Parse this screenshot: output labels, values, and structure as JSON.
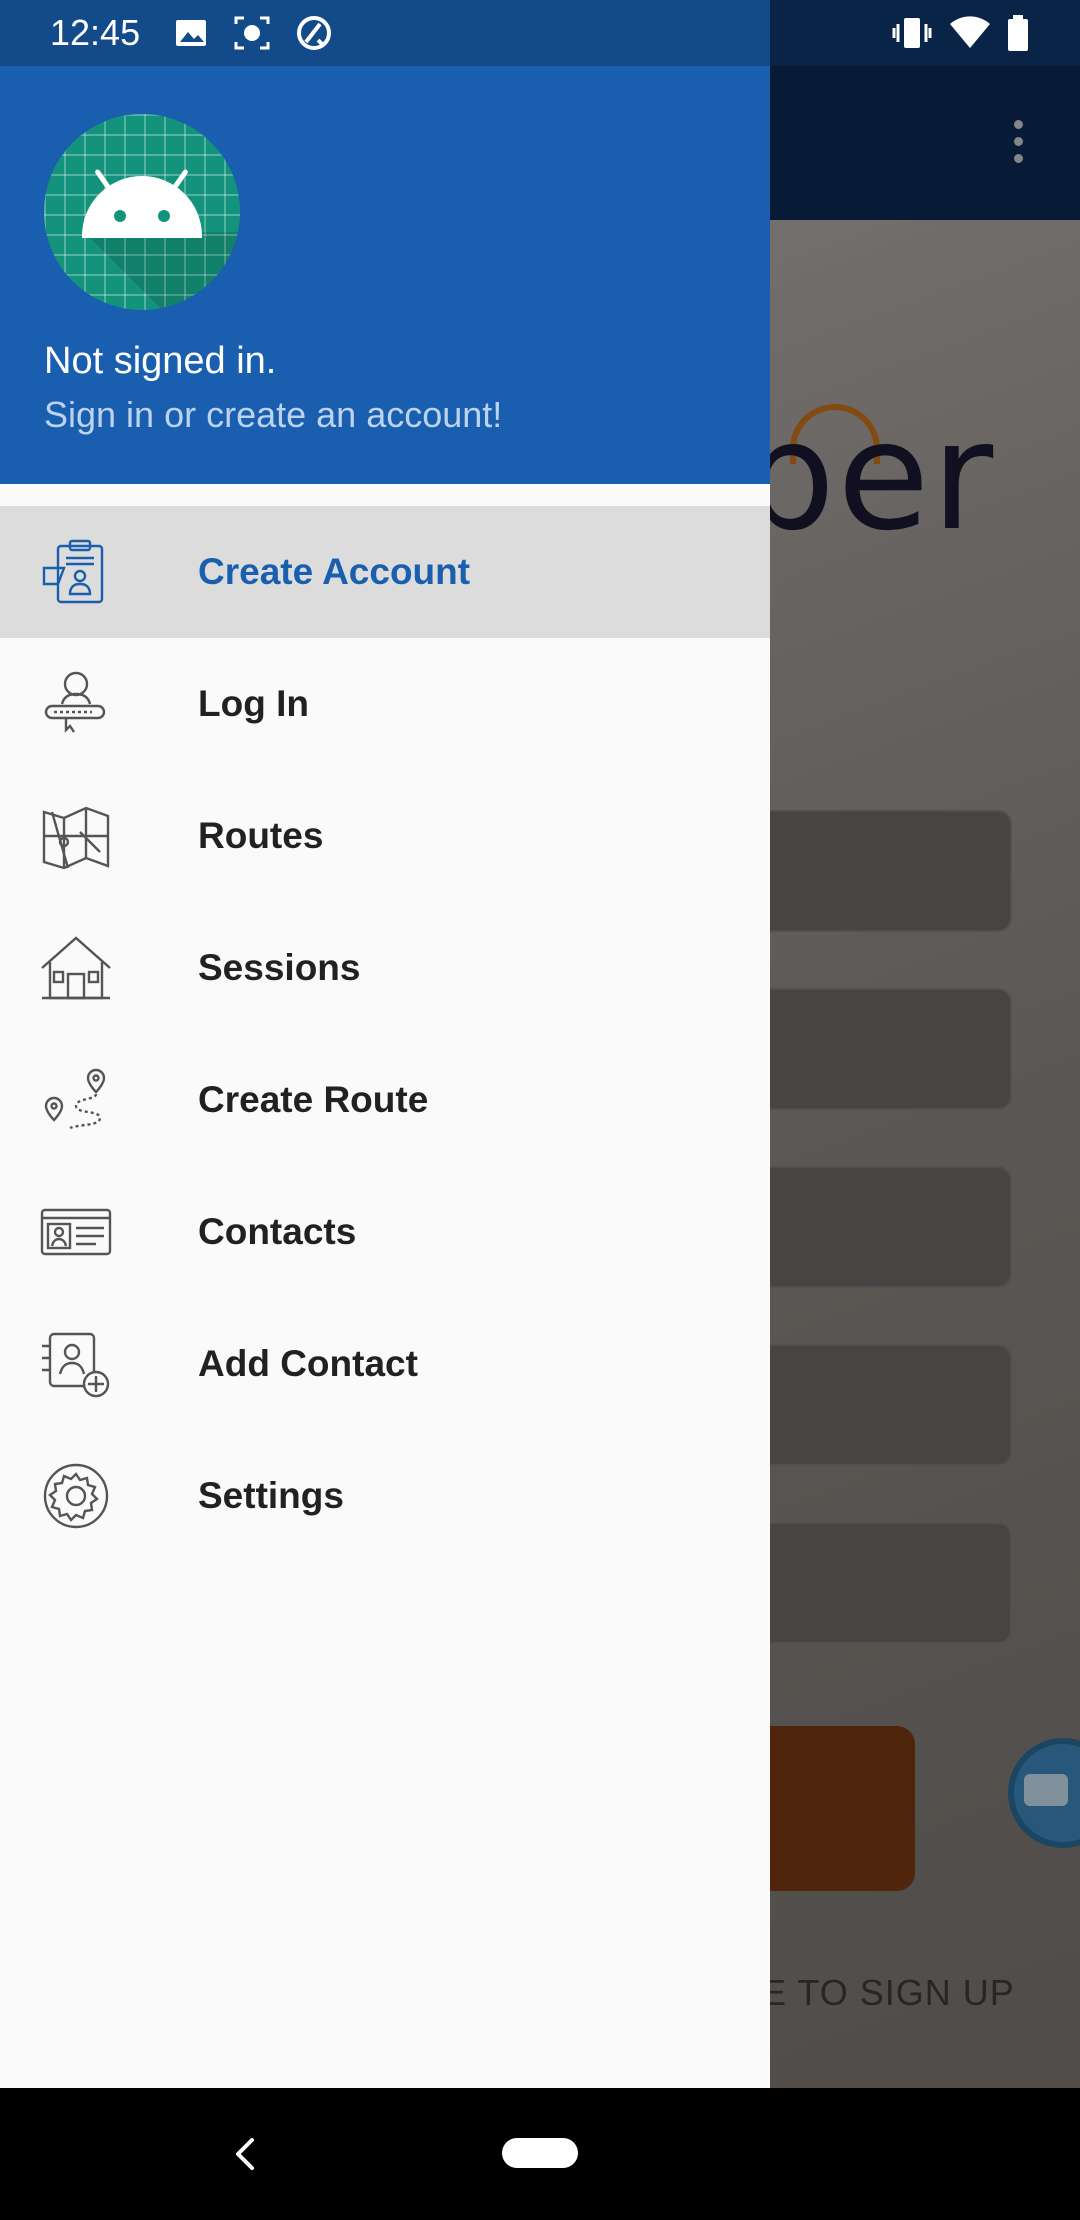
{
  "status_bar": {
    "time": "12:45",
    "icons_left": [
      "image-icon",
      "screenshot-icon",
      "sync-icon"
    ],
    "icons_right": [
      "vibrate-icon",
      "wifi-icon",
      "battery-icon"
    ]
  },
  "background_app": {
    "logo_text": "ber",
    "signup_link": "E TO SIGN UP",
    "colors": {
      "toolbar": "#0b2a55",
      "accent": "#c9731d",
      "button": "#7a3a12",
      "fab": "#3d88bf"
    }
  },
  "drawer": {
    "header": {
      "title": "Not signed in.",
      "subtitle": "Sign in or create an account!",
      "avatar_icon": "android-avatar-icon",
      "background_color": "#1a5eaf"
    },
    "items": [
      {
        "label": "Create Account",
        "icon": "create-account-icon",
        "active": true
      },
      {
        "label": "Log In",
        "icon": "login-icon",
        "active": false
      },
      {
        "label": "Routes",
        "icon": "map-icon",
        "active": false
      },
      {
        "label": "Sessions",
        "icon": "house-icon",
        "active": false
      },
      {
        "label": "Create Route",
        "icon": "route-pins-icon",
        "active": false
      },
      {
        "label": "Contacts",
        "icon": "contact-card-icon",
        "active": false
      },
      {
        "label": "Add Contact",
        "icon": "add-contact-icon",
        "active": false
      },
      {
        "label": "Settings",
        "icon": "gear-icon",
        "active": false
      }
    ],
    "active_color": "#1a5eaf"
  },
  "nav_bar": {
    "buttons": [
      "back-icon",
      "home-pill"
    ]
  }
}
